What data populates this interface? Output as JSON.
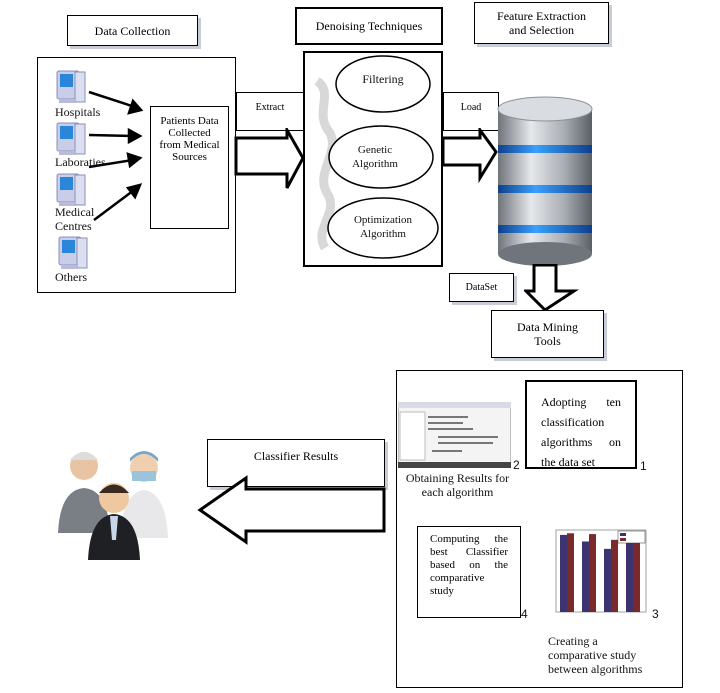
{
  "headers": {
    "data_collection": "Data Collection",
    "denoising": "Denoising Techniques",
    "feature_extraction": "Feature Extraction and Selection"
  },
  "sources": [
    {
      "label": "Hospitals",
      "icon": "computer-icon"
    },
    {
      "label": "Laboraties",
      "icon": "computer-icon"
    },
    {
      "label": "Medical Centres",
      "icon": "computer-icon"
    },
    {
      "label": "Others",
      "icon": "computer-icon"
    }
  ],
  "patients_box": "Patients Data Collected from Medical Sources",
  "extract_label": "Extract",
  "load_label": "Load",
  "techniques": [
    "Filtering",
    "Genetic Algorithm",
    "Optimization Algorithm"
  ],
  "dataset_label": "DataSet",
  "data_mining_tools": "Data Mining Tools",
  "classifier_results": "Classifier Results",
  "steps": {
    "step1": {
      "text": "Adopting ten classification algorithms on the data set",
      "number": "1"
    },
    "step2": {
      "text": "Obtaining Results for each algorithm",
      "number": "2"
    },
    "step3": {
      "text": "Creating a comparative study between algorithms",
      "number": "3"
    },
    "step4": {
      "text": "Computing the best Classifier based on the comparative study",
      "number": "4"
    }
  },
  "mini_chart": {
    "series_colors": [
      "#3b3470",
      "#7a2a2a"
    ],
    "values": [
      [
        94,
        96
      ],
      [
        86,
        95
      ],
      [
        77,
        88
      ],
      [
        90,
        92
      ]
    ]
  },
  "colors": {
    "db_band": "#2f7fe0",
    "db_body": "#a9aeb5"
  }
}
